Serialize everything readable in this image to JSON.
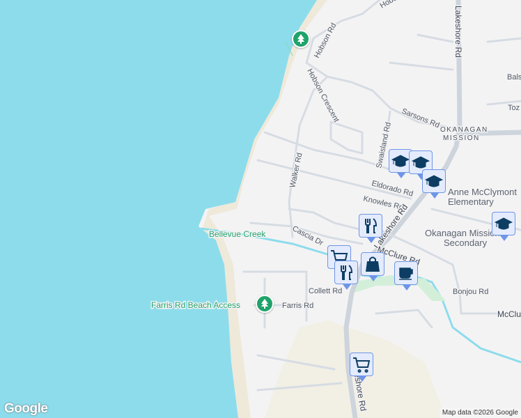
{
  "map": {
    "colors": {
      "water": "#8ddcec",
      "land": "#f4f3f4",
      "road": "#d6dce3",
      "park": "#1fa36b",
      "marker_bg": "#e3ebfd",
      "marker_icon": "#0d3d63"
    },
    "labels": {
      "hobson_rd_top": "Hobson",
      "hobson_rd": "Hobson Rd",
      "hobson_crescent": "Hobson Crescent",
      "lakeshore_rd_top": "Lakeshore Rd",
      "lakeshore_rd_mid": "Lakeshore Rd",
      "lakeshore_rd_bottom": "Lakeshore Rd",
      "sarsons_rd": "Sarsons Rd",
      "okanagan": "OKANAGAN",
      "mission": "MISSION",
      "swaisland_rd": "Swaisland Rd",
      "walker_rd": "Walker Rd",
      "eldorado_rd": "Eldorado Rd",
      "knowles_rd": "Knowles Rd",
      "cascia_dr": "Cascia Dr",
      "mcclure_rd": "McClure Rd",
      "mcclure_rd_right": "McClure Rd",
      "bonjou_rd": "Bonjou Rd",
      "collett_rd": "Collett Rd",
      "farris_rd": "Farris Rd",
      "bals": "Bals",
      "toz": "Toz",
      "bellevue_creek": "Bellevue Creek",
      "farris_beach": "Farris Rd Beach Access",
      "anne_1": "Anne McClymont",
      "anne_2": "Elementary",
      "okm_1": "Okanagan Mission",
      "okm_2": "Secondary"
    },
    "markers": [
      {
        "type": "school",
        "icon": "graduation-cap-icon"
      },
      {
        "type": "school",
        "icon": "graduation-cap-icon"
      },
      {
        "type": "school",
        "icon": "graduation-cap-icon"
      },
      {
        "type": "school",
        "icon": "graduation-cap-icon"
      },
      {
        "type": "restaurant",
        "icon": "fork-knife-icon"
      },
      {
        "type": "grocery",
        "icon": "shopping-cart-icon"
      },
      {
        "type": "restaurant",
        "icon": "fork-knife-icon"
      },
      {
        "type": "shopping",
        "icon": "shopping-bag-icon"
      },
      {
        "type": "cafe",
        "icon": "coffee-cup-icon"
      },
      {
        "type": "grocery",
        "icon": "shopping-cart-icon"
      }
    ],
    "logo": "Google",
    "attribution": "Map data ©2026 Google"
  }
}
